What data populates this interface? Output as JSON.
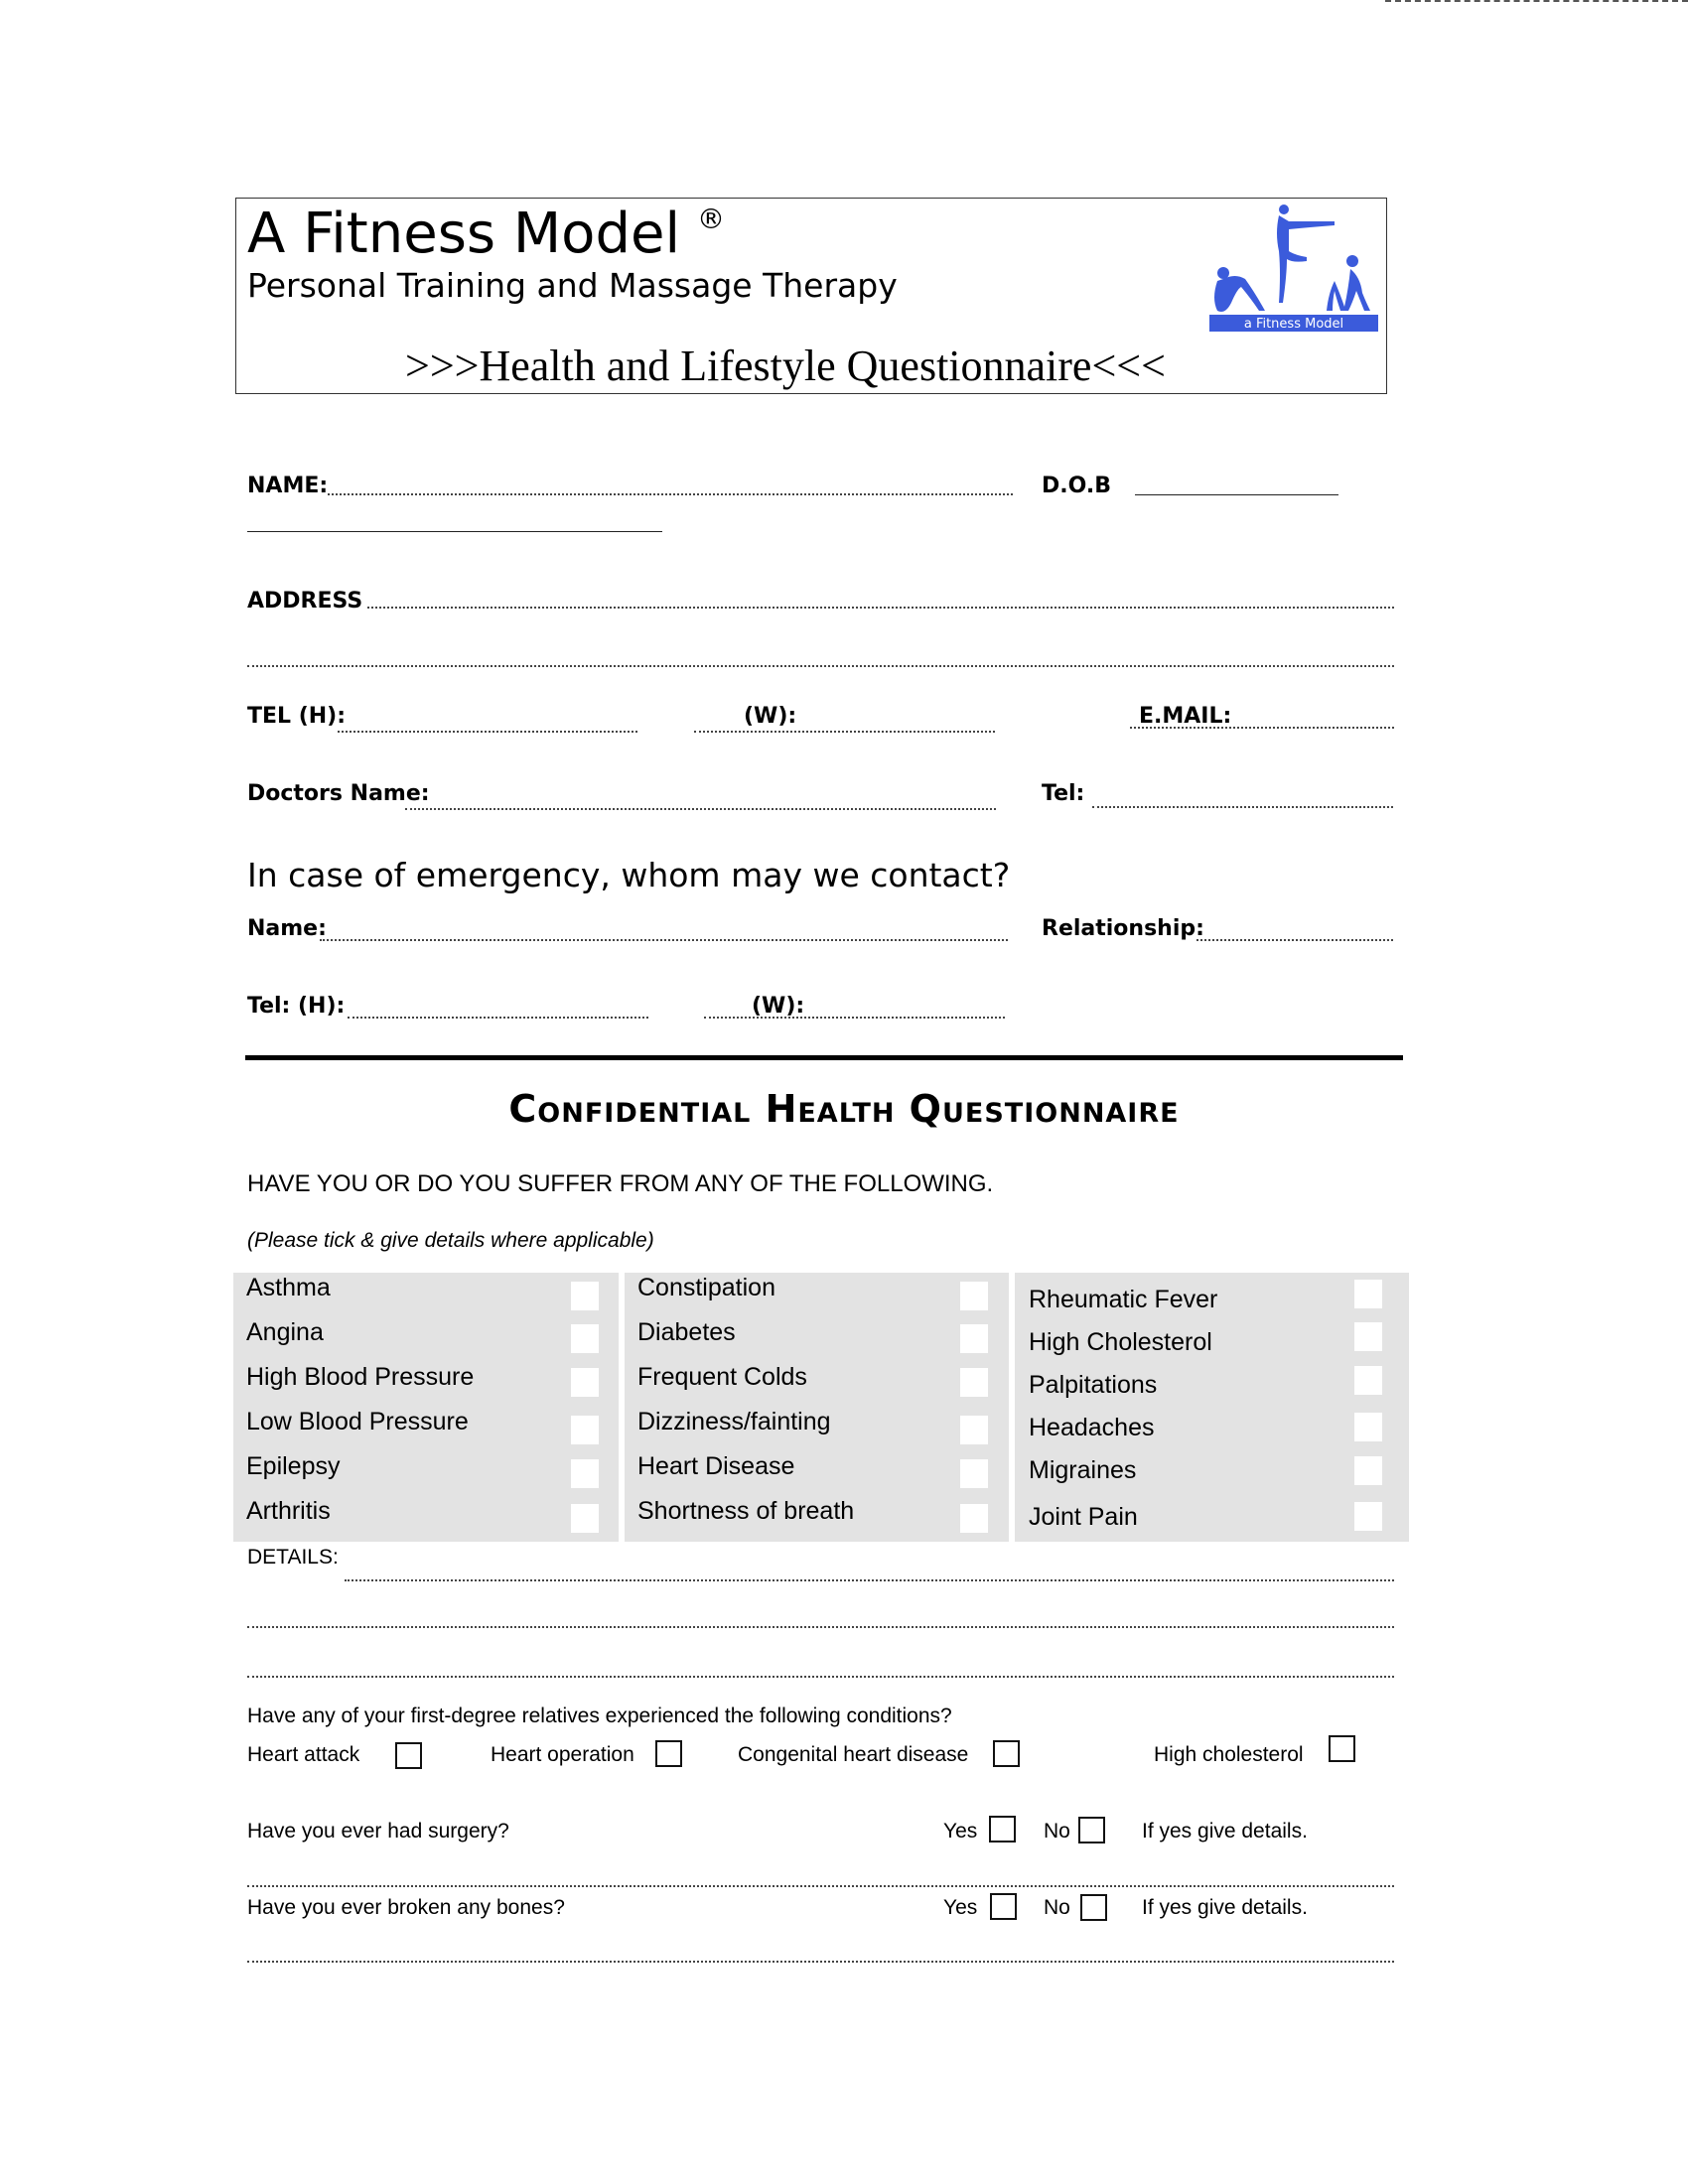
{
  "header": {
    "brand_title": "A Fitness Model",
    "registered_mark": "®",
    "brand_subtitle": "Personal Training and Massage Therapy",
    "document_title": ">>>Health and Lifestyle Questionnaire<<<",
    "logo_text": "a Fitness Model",
    "brand_color": "#3b5bdb"
  },
  "personal": {
    "name_label": "NAME:",
    "dob_label": "D.O.B",
    "address_label": "ADDRESS",
    "tel_h_label": "TEL  (H):",
    "tel_w_label": "(W):",
    "email_label": "E.MAIL:",
    "doctor_label": "Doctors Name:",
    "doctor_tel_label": "Tel:"
  },
  "emergency": {
    "heading": "In case of emergency, whom may we contact?",
    "name_label": "Name:",
    "relationship_label": "Relationship:",
    "tel_h_label": "Tel:  (H):",
    "tel_w_label": "(W):"
  },
  "health": {
    "title": "Confidential Health Questionnaire",
    "question": "HAVE YOU OR DO YOU SUFFER FROM ANY OF THE FOLLOWING.",
    "instruction": "(Please tick & give details where applicable)",
    "columns": [
      [
        "Asthma",
        "Angina",
        "High Blood Pressure",
        "Low Blood Pressure",
        "Epilepsy",
        "Arthritis"
      ],
      [
        "Constipation",
        "Diabetes",
        "Frequent Colds",
        "Dizziness/fainting",
        "Heart Disease",
        "Shortness of breath"
      ],
      [
        "Rheumatic Fever",
        "High Cholesterol",
        "Palpitations",
        "Headaches",
        "Migraines",
        "Joint Pain"
      ]
    ],
    "details_label": "DETAILS:"
  },
  "family": {
    "question": "Have any of your first-degree relatives experienced the following conditions?",
    "conditions": [
      "Heart attack",
      "Heart operation",
      "Congenital heart disease",
      "High cholesterol"
    ]
  },
  "history": [
    {
      "question": "Have you ever had surgery?",
      "yes": "Yes",
      "no": "No",
      "note": "If yes give details."
    },
    {
      "question": "Have you ever broken any bones?",
      "yes": "Yes",
      "no": "No",
      "note": "If yes give details."
    }
  ]
}
